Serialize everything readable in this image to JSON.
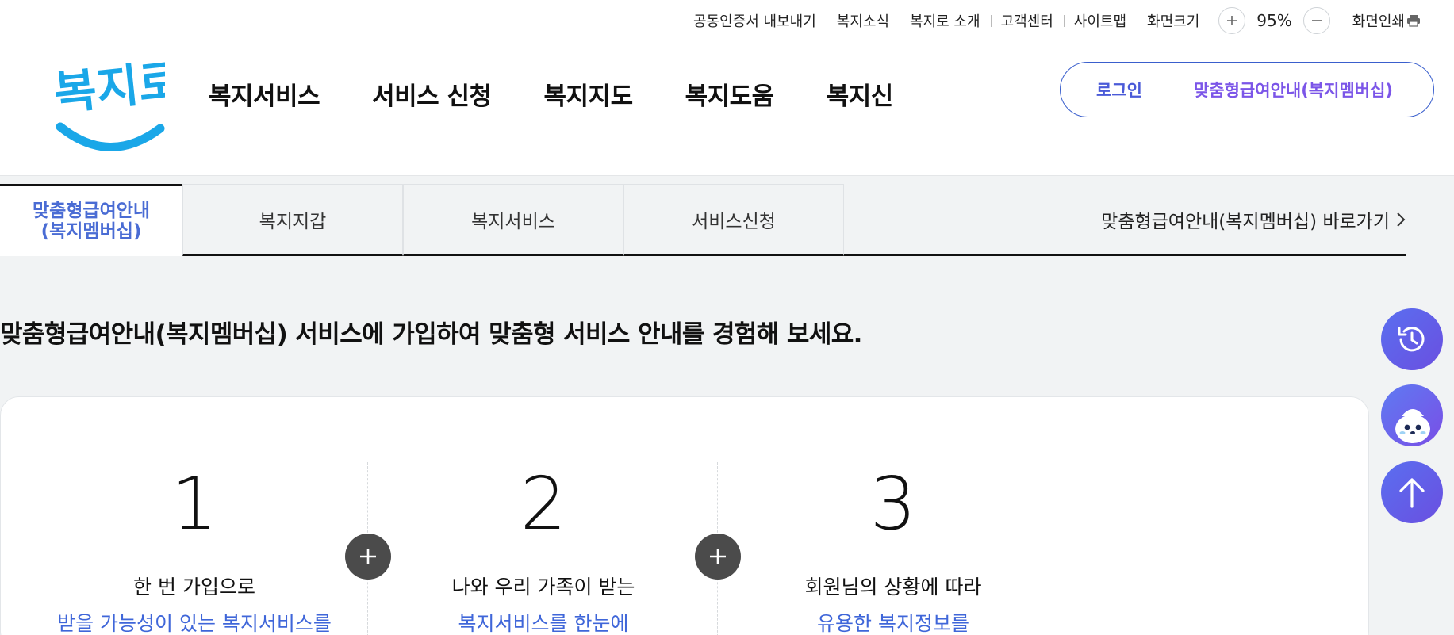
{
  "util_nav": {
    "links": [
      "공동인증서 내보내기",
      "복지소식",
      "복지로 소개",
      "고객센터",
      "사이트맵",
      "화면크기"
    ],
    "zoom_in_icon": "plus-icon",
    "zoom_value": "95%",
    "zoom_out_icon": "minus-icon",
    "print_label": "화면인쇄",
    "print_icon": "printer-icon"
  },
  "logo": {
    "text": "복지로",
    "color": "#1aa7e8"
  },
  "gnb": {
    "menus": [
      "복지서비스",
      "서비스 신청",
      "복지지도",
      "복지도움",
      "복지신"
    ]
  },
  "auth": {
    "login_label": "로그인",
    "membership_label": "맞춤형급여안내(복지멤버십)"
  },
  "tabs": {
    "active_line1": "맞춤형급여안내",
    "active_line2": "(복지멤버십)",
    "items": [
      "복지지갑",
      "복지서비스",
      "서비스신청"
    ],
    "shortcut_label": "맞춤형급여안내(복지멤버십) 바로가기",
    "shortcut_icon": "chevron-right-icon"
  },
  "main": {
    "headline": "맞춤형급여안내(복지멤버십) 서비스에 가입하여 맞춤형 서비스 안내를 경험해 보세요.",
    "steps": [
      {
        "number": "1",
        "line1": "한 번 가입으로",
        "line2": "받을 가능성이 있는 복지서비스를"
      },
      {
        "number": "2",
        "line1": "나와 우리 가족이 받는",
        "line2": "복지서비스를 한눈에"
      },
      {
        "number": "3",
        "line1": "회원님의 상황에 따라",
        "line2": "유용한 복지정보를"
      }
    ],
    "plus_icon": "plus-icon"
  },
  "floating": {
    "history_icon": "history-icon",
    "chatbot_icon": "chatbot-mascot-icon",
    "top_icon": "arrow-up-icon"
  },
  "colors": {
    "accent_blue": "#3f66d9",
    "accent_purple": "#7b55e8",
    "float_gradient_start": "#5a6ff0",
    "float_gradient_end": "#6a4fe0"
  }
}
